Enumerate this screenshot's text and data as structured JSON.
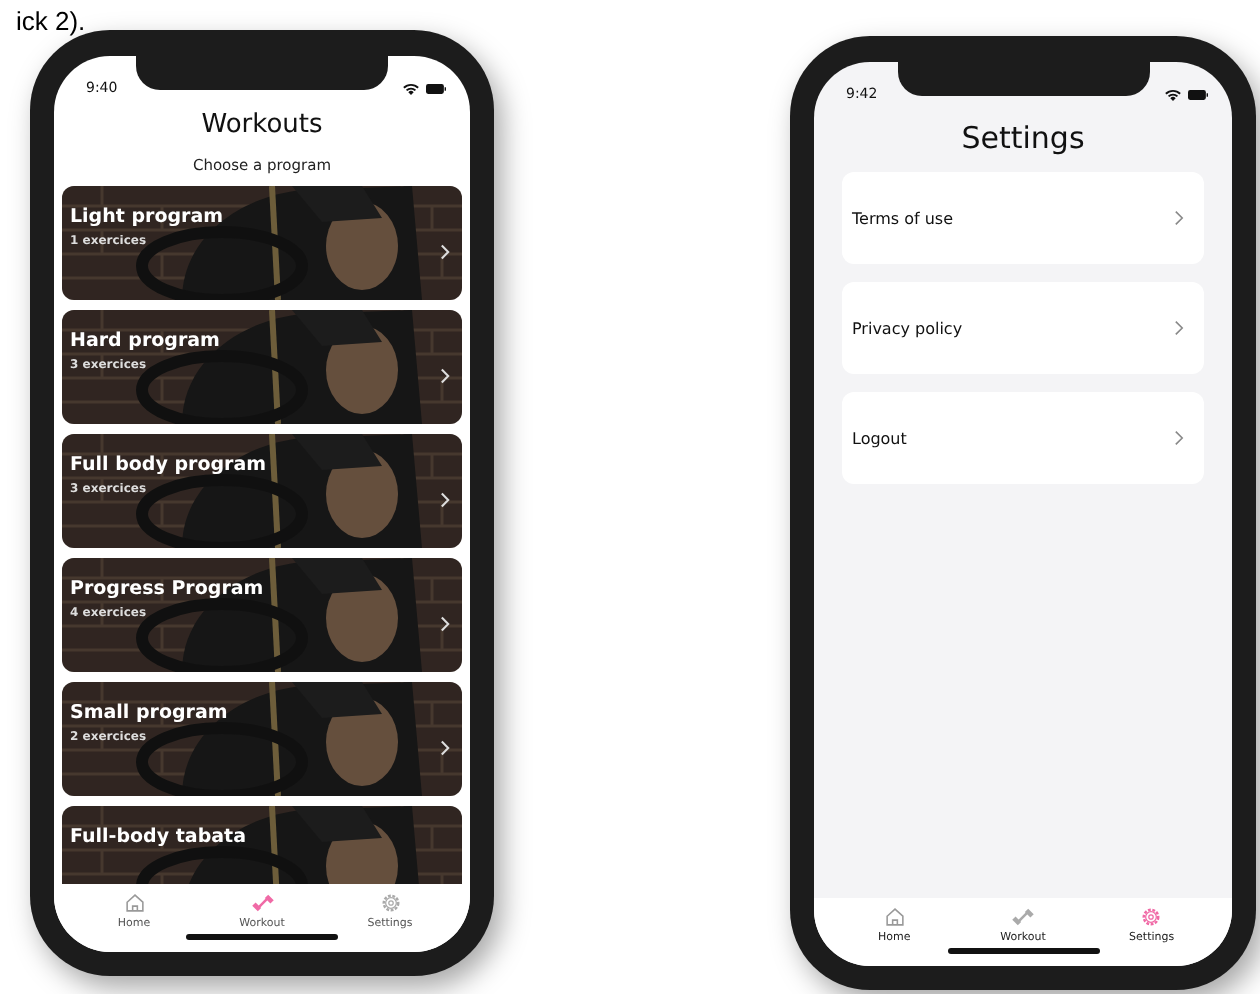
{
  "caption": "ick 2).",
  "phones": [
    {
      "kind": "workouts",
      "time": "9:40",
      "title": "Workouts",
      "subtitle": "Choose a program",
      "programs": [
        {
          "name": "Light program",
          "count": "1 exercices"
        },
        {
          "name": "Hard program",
          "count": "3 exercices"
        },
        {
          "name": "Full body program",
          "count": "3 exercices"
        },
        {
          "name": "Progress Program",
          "count": "4 exercices"
        },
        {
          "name": "Small program",
          "count": "2 exercices"
        },
        {
          "name": "Full-body tabata"
        }
      ],
      "tabs": [
        {
          "label": "Home",
          "selected": false
        },
        {
          "label": "Workout",
          "selected": true
        },
        {
          "label": "Settings",
          "selected": false
        }
      ]
    },
    {
      "kind": "settings",
      "time": "9:42",
      "title": "Settings",
      "rows": [
        {
          "label": "Terms of use"
        },
        {
          "label": "Privacy policy"
        },
        {
          "label": "Logout"
        }
      ],
      "tabs": [
        {
          "label": "Home",
          "selected": false
        },
        {
          "label": "Workout",
          "selected": false
        },
        {
          "label": "Settings",
          "selected": true
        }
      ]
    }
  ]
}
